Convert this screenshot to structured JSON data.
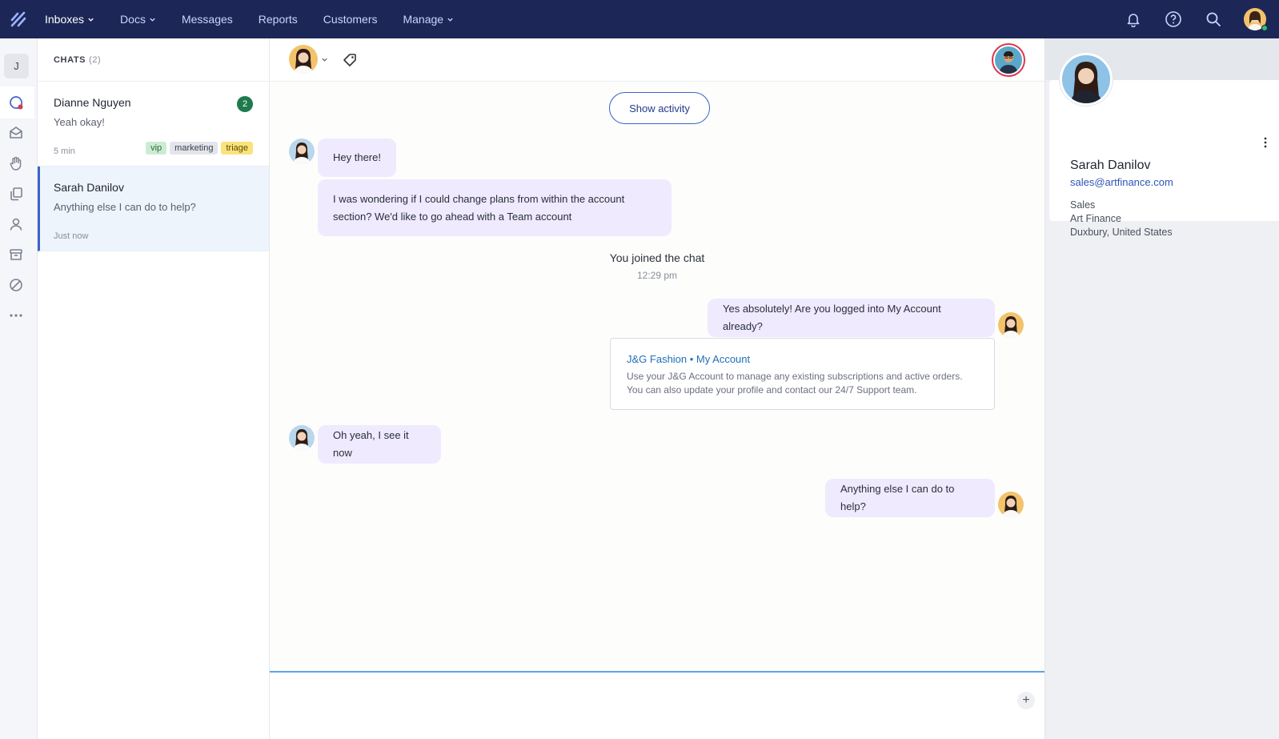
{
  "nav": {
    "items": [
      {
        "label": "Inboxes",
        "has_dropdown": true,
        "active": true
      },
      {
        "label": "Docs",
        "has_dropdown": true,
        "active": false
      },
      {
        "label": "Messages",
        "has_dropdown": false,
        "active": false
      },
      {
        "label": "Reports",
        "has_dropdown": false,
        "active": false
      },
      {
        "label": "Customers",
        "has_dropdown": false,
        "active": false
      },
      {
        "label": "Manage",
        "has_dropdown": true,
        "active": false
      }
    ],
    "icons": [
      "bell-icon",
      "help-icon",
      "search-icon",
      "user-avatar"
    ],
    "brand_color": "#1d2757"
  },
  "rail": {
    "workspace_initial": "J",
    "icons": [
      "chat-icon",
      "mail-icon",
      "hand-icon",
      "pages-icon",
      "person-icon",
      "archive-icon",
      "blocked-icon",
      "more-icon"
    ]
  },
  "chats": {
    "title": "CHATS",
    "count": "(2)",
    "items": [
      {
        "name": "Dianne Nguyen",
        "preview": "Yeah okay!",
        "time": "5 min",
        "unread": "2",
        "tags": [
          {
            "label": "vip",
            "bg": "#cdebd3",
            "fg": "#2c6b3d"
          },
          {
            "label": "marketing",
            "bg": "#e3e5ea",
            "fg": "#3a3f4c"
          },
          {
            "label": "triage",
            "bg": "#fbe27a",
            "fg": "#5a4a00"
          }
        ]
      },
      {
        "name": "Sarah Danilov",
        "preview": "Anything else I can do to help?",
        "time": "Just now"
      }
    ]
  },
  "conversation": {
    "show_activity": "Show activity",
    "messages": {
      "m1": "Hey there!",
      "m2": "I was wondering if I could change plans from within the account section? We'd like to go ahead with a Team account",
      "system": "You joined the chat",
      "system_time": "12:29 pm",
      "m3": "Yes absolutely! Are you logged into My Account already?",
      "m4": "Oh yeah, I see it now",
      "m5": "Anything else I can do to help?"
    },
    "link_card": {
      "title": "J&G Fashion • My Account",
      "description": "Use your J&G Account to manage any existing subscriptions and active orders. You can also update your profile and contact our 24/7 Support team."
    },
    "composer_add": "+"
  },
  "customer": {
    "name": "Sarah Danilov",
    "email": "sales@artfinance.com",
    "role": "Sales",
    "company": "Art Finance",
    "location": "Duxbury, United States"
  }
}
